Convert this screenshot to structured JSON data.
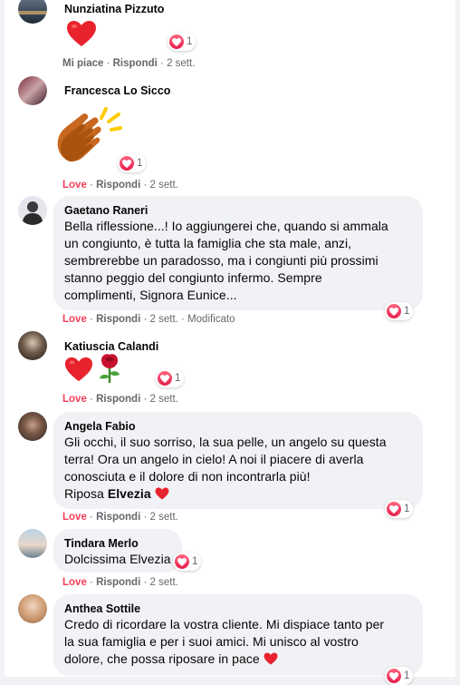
{
  "colors": {
    "love": "#f33e58",
    "bubble": "#f0f2f5",
    "meta": "#65676b"
  },
  "comments": [
    {
      "name": "Nunziatina Pizzuto",
      "reactions": "1",
      "like": "Mi piace",
      "reply": "Rispondi",
      "time": "2 sett."
    },
    {
      "name": "Francesca Lo Sicco",
      "reactions": "1",
      "like": "Love",
      "reply": "Rispondi",
      "time": "2 sett."
    },
    {
      "name": "Gaetano Raneri",
      "lines": [
        "Bella riflessione...! Io aggiungerei che, quando si ammala",
        "un congiunto, è tutta la famiglia che sta male, anzi,",
        "sembrerebbe un paradosso, ma i congiunti più prossimi",
        "stanno peggio del congiunto infermo. Sempre",
        "complimenti, Signora Eunice..."
      ],
      "reactions": "1",
      "like": "Love",
      "reply": "Rispondi",
      "time": "2 sett.",
      "edited": "Modificato"
    },
    {
      "name": "Katiuscia Calandi",
      "reactions": "1",
      "like": "Love",
      "reply": "Rispondi",
      "time": "2 sett."
    },
    {
      "name": "Angela Fabio",
      "lines": [
        "Gli occhi, il suo sorriso, la sua pelle, un angelo su questa",
        "terra! Ora un angelo in cielo! A noi il piacere di averla",
        "conosciuta e il dolore di non incontrarla più!"
      ],
      "last_prefix": "Riposa ",
      "last_bold": "Elvezia",
      "reactions": "1",
      "like": "Love",
      "reply": "Rispondi",
      "time": "2 sett."
    },
    {
      "name": "Tindara Merlo",
      "text": "Dolcissima Elvezia",
      "reactions": "1",
      "like": "Love",
      "reply": "Rispondi",
      "time": "2 sett."
    },
    {
      "name": "Anthea Sottile",
      "lines": [
        "Credo di ricordare la vostra cliente. Mi dispiace tanto per",
        "la sua famiglia e per i suoi amici. Mi unisco al vostro"
      ],
      "last_line": "dolore, che possa riposare in pace",
      "reactions": "1"
    }
  ]
}
